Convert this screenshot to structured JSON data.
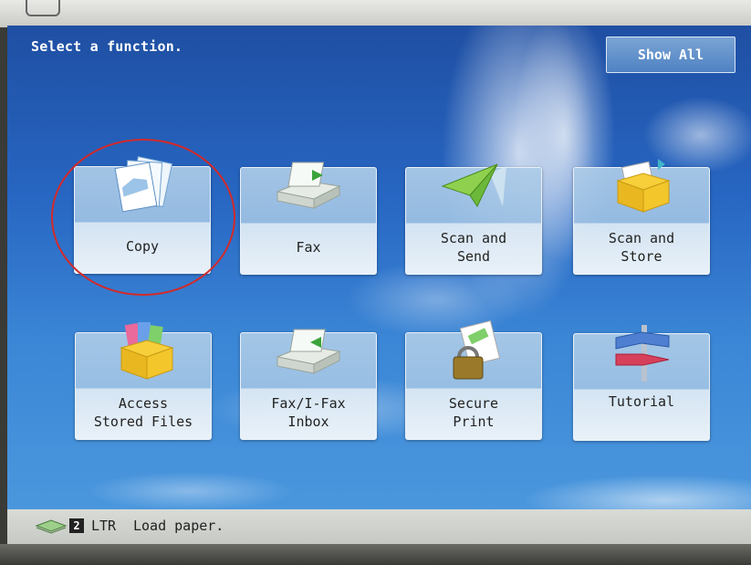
{
  "header": {
    "prompt": "Select a function.",
    "show_all_label": "Show All"
  },
  "functions": [
    {
      "label": "Copy",
      "icon": "copy-icon"
    },
    {
      "label": "Fax",
      "icon": "fax-icon"
    },
    {
      "label": "Scan and\nSend",
      "icon": "scan-send-icon"
    },
    {
      "label": "Scan and\nStore",
      "icon": "scan-store-icon"
    },
    {
      "label": "Access\nStored Files",
      "icon": "stored-files-icon"
    },
    {
      "label": "Fax/I-Fax\nInbox",
      "icon": "fax-inbox-icon"
    },
    {
      "label": "Secure\nPrint",
      "icon": "secure-print-icon"
    },
    {
      "label": "Tutorial",
      "icon": "tutorial-icon"
    }
  ],
  "status_bar": {
    "tray_number": "2",
    "paper_size": "LTR",
    "message": "Load paper."
  },
  "colors": {
    "screen_top": "#1f4fa3",
    "screen_bottom": "#4b97dd",
    "highlight_circle": "#d22a2a"
  }
}
